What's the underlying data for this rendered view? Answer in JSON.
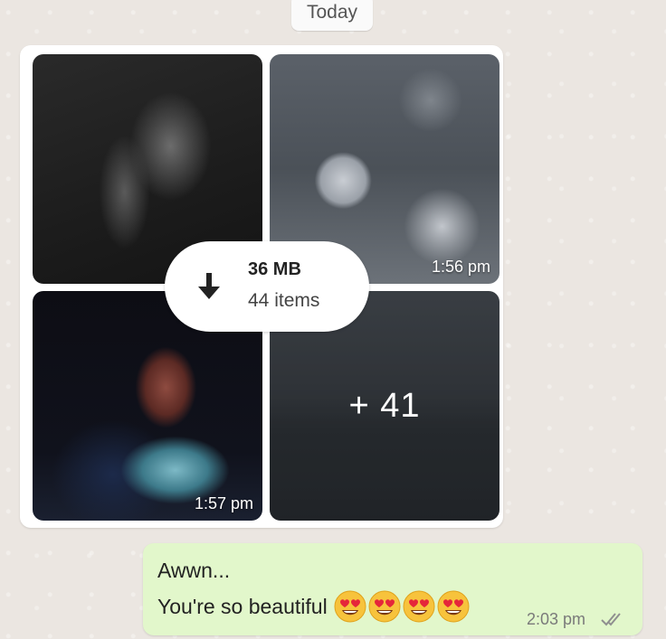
{
  "date_chip": {
    "label": "Today"
  },
  "album": {
    "tiles": [
      {
        "timestamp": ""
      },
      {
        "timestamp": "1:56 pm"
      },
      {
        "timestamp": "1:57 pm"
      },
      {
        "more_label": "+ 41"
      }
    ],
    "download": {
      "size": "36 MB",
      "count": "44 items",
      "icon": "download-arrow-icon"
    }
  },
  "outgoing_message": {
    "line1": "Awwn...",
    "line2": "You're so beautiful",
    "emojis": [
      "heart-eyes-emoji",
      "heart-eyes-emoji",
      "heart-eyes-emoji",
      "heart-eyes-emoji"
    ],
    "time": "2:03 pm",
    "status_icon": "double-check-icon"
  },
  "colors": {
    "outgoing_bubble": "#e2f7cb",
    "incoming_bubble": "#ffffff",
    "wallpaper": "#ebe6e1",
    "read_tick": "#9a9a9a"
  }
}
